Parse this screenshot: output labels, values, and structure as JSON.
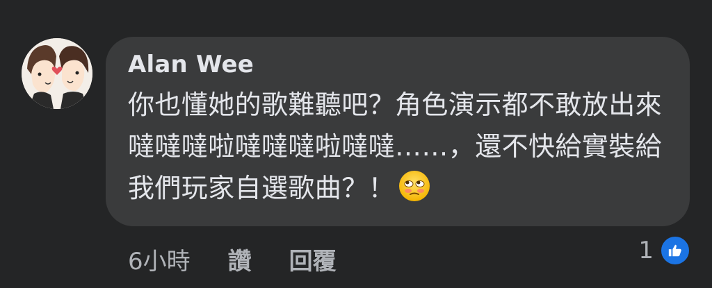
{
  "comment": {
    "author": "Alan Wee",
    "message": "你也懂她的歌難聽吧？角色演示都不敢放出來噠噠噠啦噠噠噠啦噠噠……，還不快給實裝給我們玩家自選歌曲？！",
    "emoji": "flushed-rolling-eyes-face",
    "timestamp": "6小時",
    "like_label": "讚",
    "reply_label": "回覆",
    "reaction_count": "1",
    "reaction_type": "like-icon"
  },
  "colors": {
    "background": "#242526",
    "bubble": "#3a3b3c",
    "text": "#e4e6eb",
    "secondary_text": "#b0b3b8",
    "like_blue": "#1b74e4"
  }
}
